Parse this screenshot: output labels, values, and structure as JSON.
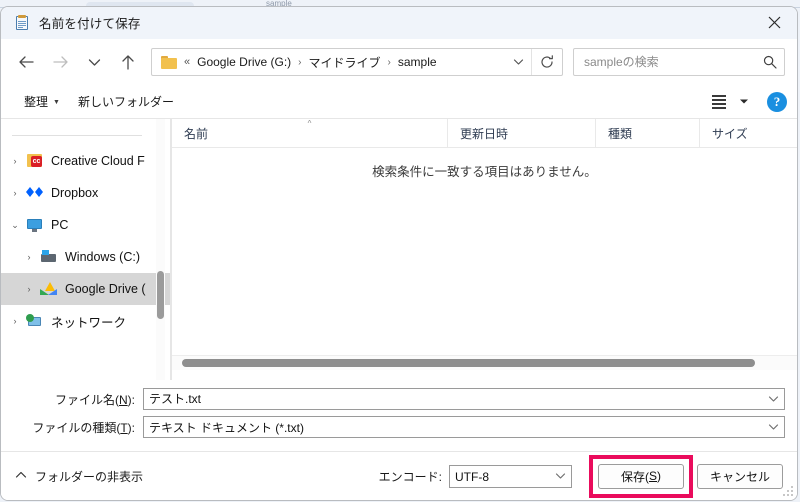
{
  "background": {
    "tab_hint": "sample"
  },
  "window": {
    "title": "名前を付けて保存",
    "title_icon": "notepad-icon",
    "close_label": "✕"
  },
  "nav": {
    "back_icon": "arrow-left-icon",
    "forward_icon": "arrow-right-icon",
    "history_icon": "chevron-down-icon",
    "up_icon": "arrow-up-icon",
    "address": {
      "folder_icon": "folder-icon",
      "prefix": "«",
      "crumbs": [
        "Google Drive (G:)",
        "マイドライブ",
        "sample"
      ],
      "separator": "›",
      "dropdown_icon": "chevron-down-icon",
      "refresh_icon": "refresh-icon"
    },
    "search": {
      "placeholder": "sampleの検索",
      "value": "",
      "icon": "search-icon"
    }
  },
  "toolbar": {
    "organize_label": "整理",
    "organize_caret": "▼",
    "new_folder_label": "新しいフォルダー",
    "view_icon": "list-view-icon",
    "view_caret": "▼",
    "help_label": "?"
  },
  "sidebar": {
    "items": [
      {
        "label": "Creative Cloud F",
        "icon": "creative-cloud-icon",
        "chevron": "›",
        "indent": false,
        "selected": false
      },
      {
        "label": "Dropbox",
        "icon": "dropbox-icon",
        "chevron": "›",
        "indent": false,
        "selected": false
      },
      {
        "label": "PC",
        "icon": "pc-icon",
        "chevron": "⌄",
        "indent": false,
        "selected": false
      },
      {
        "label": "Windows (C:)",
        "icon": "harddrive-icon",
        "chevron": "›",
        "indent": true,
        "selected": false
      },
      {
        "label": "Google Drive (",
        "icon": "google-drive-icon",
        "chevron": "›",
        "indent": true,
        "selected": true
      },
      {
        "label": "ネットワーク",
        "icon": "network-icon",
        "chevron": "›",
        "indent": false,
        "selected": false
      }
    ]
  },
  "filelist": {
    "columns": [
      {
        "label": "名前",
        "sorted": true,
        "sort_caret": "^"
      },
      {
        "label": "更新日時",
        "sorted": false,
        "sort_caret": ""
      },
      {
        "label": "種類",
        "sorted": false,
        "sort_caret": ""
      },
      {
        "label": "サイズ",
        "sorted": false,
        "sort_caret": ""
      }
    ],
    "rows": [],
    "empty_message": "検索条件に一致する項目はありません。"
  },
  "fields": {
    "filename": {
      "label_pre": "ファイル名(",
      "label_key": "N",
      "label_post": "):",
      "value": "テスト.txt",
      "caret": "⌄"
    },
    "filetype": {
      "label_pre": "ファイルの種類(",
      "label_key": "T",
      "label_post": "):",
      "value": "テキスト ドキュメント (*.txt)",
      "caret": "⌄"
    }
  },
  "footer": {
    "hide_folders_label": "フォルダーの非表示",
    "hide_folders_caret": "⌃",
    "encoding_label": "エンコード:",
    "encoding_value": "UTF-8",
    "encoding_caret": "⌄",
    "save_pre": "保存(",
    "save_key": "S",
    "save_post": ")",
    "cancel_label": "キャンセル"
  },
  "colors": {
    "highlight": "#ea0b5c",
    "titlebar": "#f0f4fa",
    "selection": "#d6d6d6",
    "accent_blue": "#1a8fe0"
  }
}
